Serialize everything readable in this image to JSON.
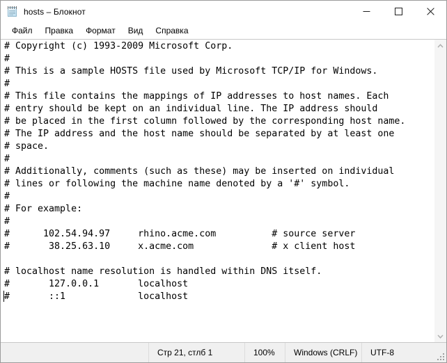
{
  "window": {
    "title": "hosts – Блокнот",
    "app_icon": "notepad-icon"
  },
  "titlebar_buttons": {
    "minimize": "minimize-icon",
    "maximize": "maximize-icon",
    "close": "close-icon"
  },
  "menubar": {
    "items": [
      {
        "label": "Файл"
      },
      {
        "label": "Правка"
      },
      {
        "label": "Формат"
      },
      {
        "label": "Вид"
      },
      {
        "label": "Справка"
      }
    ]
  },
  "editor": {
    "content": "# Copyright (c) 1993-2009 Microsoft Corp.\n#\n# This is a sample HOSTS file used by Microsoft TCP/IP for Windows.\n#\n# This file contains the mappings of IP addresses to host names. Each\n# entry should be kept on an individual line. The IP address should\n# be placed in the first column followed by the corresponding host name.\n# The IP address and the host name should be separated by at least one\n# space.\n#\n# Additionally, comments (such as these) may be inserted on individual\n# lines or following the machine name denoted by a '#' symbol.\n#\n# For example:\n#\n#      102.54.94.97     rhino.acme.com          # source server\n#       38.25.63.10     x.acme.com              # x client host\n\n# localhost name resolution is handled within DNS itself.\n#       127.0.0.1       localhost\n#       ::1             localhost",
    "caret_line": 21,
    "caret_column": 1
  },
  "scrollbar": {
    "up_arrow": "chevron-up-icon",
    "down_arrow": "chevron-down-icon"
  },
  "statusbar": {
    "position": "Стр 21, стлб 1",
    "zoom": "100%",
    "line_ending": "Windows (CRLF)",
    "encoding": "UTF-8"
  },
  "colors": {
    "window_bg": "#ffffff",
    "statusbar_bg": "#f0f0f0",
    "border": "#9b9b9b",
    "text": "#000000",
    "scrollbar_track": "#f5f5f5"
  }
}
